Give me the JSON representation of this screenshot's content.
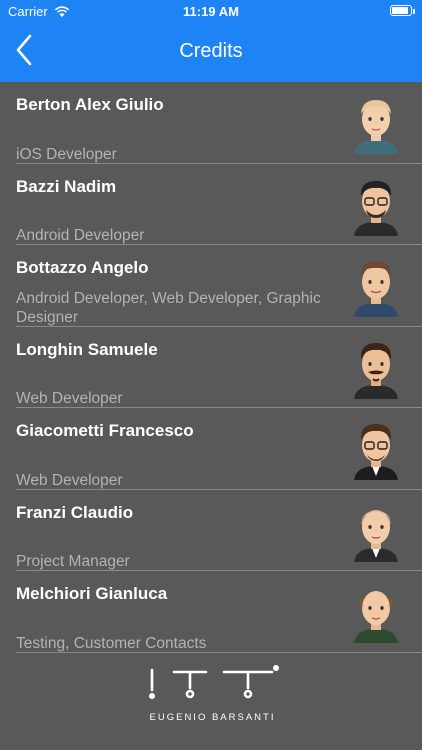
{
  "status": {
    "carrier": "Carrier",
    "time": "11:19 AM"
  },
  "nav": {
    "title": "Credits"
  },
  "credits": [
    {
      "name": "Berton Alex Giulio",
      "role": "iOS Developer"
    },
    {
      "name": "Bazzi Nadim",
      "role": "Android Developer"
    },
    {
      "name": "Bottazzo Angelo",
      "role": "Android Developer, Web Developer, Graphic Designer"
    },
    {
      "name": "Longhin Samuele",
      "role": "Web Developer"
    },
    {
      "name": "Giacometti Francesco",
      "role": "Web Developer"
    },
    {
      "name": "Franzi Claudio",
      "role": "Project Manager"
    },
    {
      "name": "Melchiori Gianluca",
      "role": "Testing, Customer Contacts"
    }
  ],
  "footer": {
    "logo_text": "EUGENIO BARSANTI"
  },
  "colors": {
    "accent": "#1e83f5",
    "background": "#595959",
    "secondary_text": "#b3b3b3"
  }
}
